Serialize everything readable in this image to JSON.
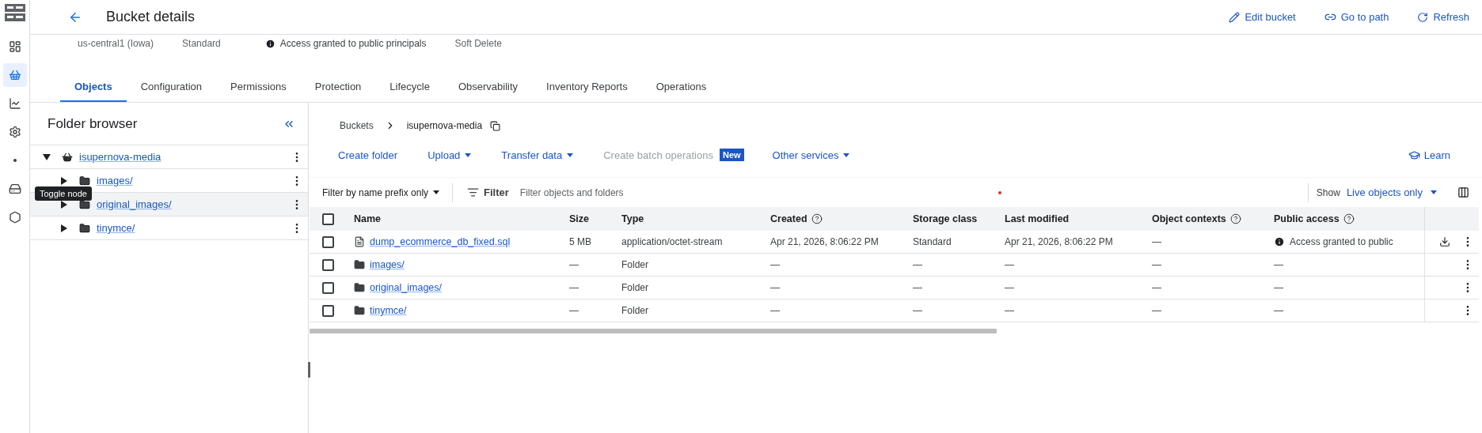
{
  "rail": [
    {
      "kind": "table",
      "selected": false
    },
    {
      "kind": "bucket",
      "selected": true
    },
    {
      "kind": "chart",
      "selected": false
    },
    {
      "kind": "settings",
      "selected": false
    },
    {
      "kind": "dot",
      "selected": false
    },
    {
      "kind": "drive",
      "selected": false
    },
    {
      "kind": "hexagon",
      "selected": false
    }
  ],
  "header": {
    "title": "Bucket details",
    "actions": [
      {
        "label": "Edit bucket",
        "kind": "edit"
      },
      {
        "label": "Go to path",
        "kind": "link"
      },
      {
        "label": "Refresh",
        "kind": "refresh"
      }
    ]
  },
  "summary": {
    "location": "us-central1 (Iowa)",
    "storage_class": "Standard",
    "public_access": "Access granted to public principals",
    "protection": "Soft Delete"
  },
  "tabs": [
    {
      "label": "Objects",
      "selected": true
    },
    {
      "label": "Configuration",
      "selected": false
    },
    {
      "label": "Permissions",
      "selected": false
    },
    {
      "label": "Protection",
      "selected": false
    },
    {
      "label": "Lifecycle",
      "selected": false
    },
    {
      "label": "Observability",
      "selected": false
    },
    {
      "label": "Inventory Reports",
      "selected": false
    },
    {
      "label": "Operations",
      "selected": false
    }
  ],
  "folder_browser": {
    "title": "Folder browser",
    "tooltip": "Toggle node",
    "tree": [
      {
        "label": "isupernova-media",
        "kind": "bucket",
        "expanded": true,
        "highlighted": false,
        "children": [
          {
            "label": "images/",
            "kind": "folder",
            "expanded": false,
            "highlighted": false
          },
          {
            "label": "original_images/",
            "kind": "folder",
            "expanded": false,
            "highlighted": true
          },
          {
            "label": "tinymce/",
            "kind": "folder",
            "expanded": false,
            "highlighted": false
          }
        ]
      }
    ]
  },
  "breadcrumb": [
    "Buckets",
    "isupernova-media"
  ],
  "toolbar": [
    {
      "label": "Create folder",
      "dropdown": false,
      "disabled": false
    },
    {
      "label": "Upload",
      "dropdown": true,
      "disabled": false
    },
    {
      "label": "Transfer data",
      "dropdown": true,
      "disabled": false
    },
    {
      "label": "Create batch operations",
      "dropdown": false,
      "disabled": true,
      "badge": "New"
    },
    {
      "label": "Other services",
      "dropdown": true,
      "disabled": false
    }
  ],
  "learn": "Learn",
  "filter": {
    "mode": "Filter by name prefix only",
    "label": "Filter",
    "placeholder": "Filter objects and folders",
    "show_label": "Show",
    "show_value": "Live objects only"
  },
  "table": {
    "all_checked": false,
    "columns": [
      {
        "label": "Name",
        "help": false
      },
      {
        "label": "Size",
        "help": false
      },
      {
        "label": "Type",
        "help": false
      },
      {
        "label": "Created",
        "help": true
      },
      {
        "label": "Storage class",
        "help": false
      },
      {
        "label": "Last modified",
        "help": false
      },
      {
        "label": "Object contexts",
        "help": true
      },
      {
        "label": "Public access",
        "help": true
      }
    ],
    "rows": [
      {
        "kind": "file",
        "checked": false,
        "cells": [
          "dump_ecommerce_db_fixed.sql",
          "5 MB",
          "application/octet-stream",
          "Apr 21, 2026, 8:06:22 PM",
          "Standard",
          "Apr 21, 2026, 8:06:22 PM",
          "—",
          "Access granted to public"
        ]
      },
      {
        "kind": "folder",
        "checked": false,
        "cells": [
          "images/",
          "—",
          "Folder",
          "—",
          "—",
          "—",
          "—",
          "—"
        ]
      },
      {
        "kind": "folder",
        "checked": false,
        "cells": [
          "original_images/",
          "—",
          "Folder",
          "—",
          "—",
          "—",
          "—",
          "—"
        ]
      },
      {
        "kind": "folder",
        "checked": false,
        "cells": [
          "tinymce/",
          "—",
          "Folder",
          "—",
          "—",
          "—",
          "—",
          "—"
        ]
      }
    ]
  }
}
